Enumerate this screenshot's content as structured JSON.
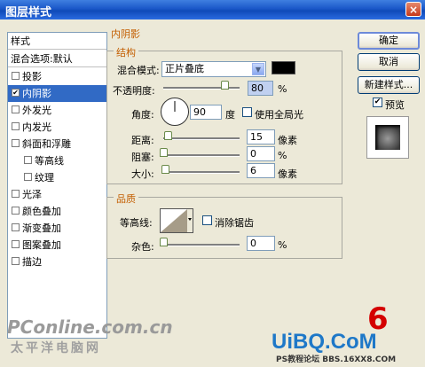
{
  "window": {
    "title": "图层样式",
    "close": "×"
  },
  "styles_panel": {
    "header": "样式",
    "blend_options": "混合选项:默认",
    "items": [
      {
        "label": "投影",
        "checked": false,
        "selected": false,
        "indent": false
      },
      {
        "label": "内阴影",
        "checked": true,
        "selected": true,
        "indent": false
      },
      {
        "label": "外发光",
        "checked": false,
        "selected": false,
        "indent": false
      },
      {
        "label": "内发光",
        "checked": false,
        "selected": false,
        "indent": false
      },
      {
        "label": "斜面和浮雕",
        "checked": false,
        "selected": false,
        "indent": false
      },
      {
        "label": "等高线",
        "checked": false,
        "selected": false,
        "indent": true
      },
      {
        "label": "纹理",
        "checked": false,
        "selected": false,
        "indent": true
      },
      {
        "label": "光泽",
        "checked": false,
        "selected": false,
        "indent": false
      },
      {
        "label": "颜色叠加",
        "checked": false,
        "selected": false,
        "indent": false
      },
      {
        "label": "渐变叠加",
        "checked": false,
        "selected": false,
        "indent": false
      },
      {
        "label": "图案叠加",
        "checked": false,
        "selected": false,
        "indent": false
      },
      {
        "label": "描边",
        "checked": false,
        "selected": false,
        "indent": false
      }
    ]
  },
  "inner_shadow": {
    "title": "内阴影",
    "structure": {
      "title": "结构",
      "blend_mode_label": "混合模式:",
      "blend_mode_value": "正片叠底",
      "color": "#000000",
      "opacity_label": "不透明度:",
      "opacity_value": "80",
      "opacity_unit": "%",
      "opacity_level": 80,
      "angle_label": "角度:",
      "angle_value": "90",
      "angle_unit": "度",
      "global_light_label": "使用全局光",
      "global_light_checked": false,
      "distance_label": "距离:",
      "distance_value": "15",
      "distance_unit": "像素",
      "distance_level": 6,
      "choke_label": "阻塞:",
      "choke_value": "0",
      "choke_unit": "%",
      "choke_level": 0,
      "size_label": "大小:",
      "size_value": "6",
      "size_unit": "像素",
      "size_level": 2.4
    },
    "quality": {
      "title": "品质",
      "contour_label": "等高线:",
      "anti_alias_label": "消除锯齿",
      "anti_alias_checked": false,
      "noise_label": "杂色:",
      "noise_value": "0",
      "noise_unit": "%",
      "noise_level": 0
    }
  },
  "buttons": {
    "ok": "确定",
    "cancel": "取消",
    "new_style": "新建样式...",
    "preview_label": "预览",
    "preview_checked": true
  },
  "watermarks": {
    "pconline": "PConline.com.cn",
    "pconline_sub": "太平洋电脑网",
    "step_number": "6",
    "uibq": "UiBQ.CoM",
    "footer": "PS教程论坛 BBS.16XX8.COM"
  },
  "colors": {
    "accent": "#c35e00",
    "selection": "#316ac5",
    "title_bar": "#1a57c8"
  }
}
